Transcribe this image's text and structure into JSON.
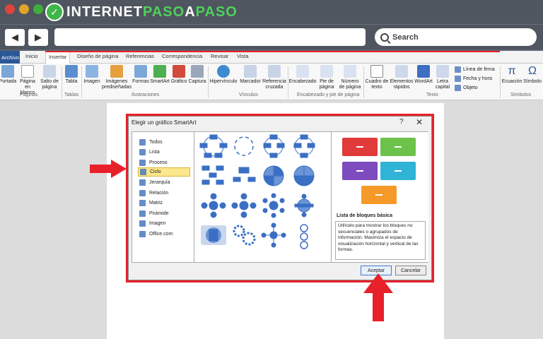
{
  "browser": {
    "brand_prefix": "INTERNET",
    "brand_green": "PASO",
    "brand_mid": "A",
    "brand_suffix": "PASO",
    "back_label": "◀",
    "forward_label": "▶",
    "search_placeholder": "Search"
  },
  "ribbon": {
    "tabs": [
      "Archivo",
      "Inicio",
      "Insertar",
      "Diseño de página",
      "Referencias",
      "Correspondencia",
      "Revisar",
      "Vista"
    ],
    "active_tab": "Insertar",
    "buttons": {
      "portada": "Portada",
      "pagina_blanco": "Página en blanco",
      "salto": "Salto de página",
      "tabla": "Tabla",
      "imagen": "Imagen",
      "imagenes_pred": "Imágenes prediseñadas",
      "formas": "Formas",
      "smartart": "SmartArt",
      "grafico": "Gráfico",
      "captura": "Captura",
      "hipervinculo": "Hipervínculo",
      "marcador": "Marcador",
      "referencia": "Referencia cruzada",
      "encabezado": "Encabezado",
      "pie": "Pie de página",
      "numero": "Número de página",
      "cuadro": "Cuadro de texto",
      "elementos": "Elementos rápidos",
      "wordart": "WordArt",
      "letra": "Letra capital",
      "linea_firma": "Línea de firma",
      "fecha_hora": "Fecha y hora",
      "objeto": "Objeto",
      "ecuacion": "Ecuación",
      "simbolo": "Símbolo"
    },
    "groups": {
      "paginas": "Páginas",
      "tablas": "Tablas",
      "ilustraciones": "Ilustraciones",
      "vinculos": "Vínculos",
      "encabezado_pie": "Encabezado y pie de página",
      "texto": "Texto",
      "simbolos": "Símbolos"
    }
  },
  "dialog": {
    "title": "Elegir un gráfico SmartArt",
    "help": "?",
    "close": "✕",
    "categories": [
      "Todos",
      "Lista",
      "Proceso",
      "Ciclo",
      "Jerarquía",
      "Relación",
      "Matriz",
      "Pirámide",
      "Imagen",
      "Office.com"
    ],
    "selected_category": "Ciclo",
    "preview_title": "Lista de bloques básica",
    "preview_description": "Utilícelo para mostrar los bloques no secuenciales o agrupados de información. Maximiza el espacio de visualización horizontal y vertical de las formas.",
    "ok_label": "Aceptar",
    "cancel_label": "Cancelar"
  },
  "colors": {
    "annotation_red": "#e8202a",
    "brand_green": "#4fd05a",
    "block_red": "#e03a3a",
    "block_green": "#6cc24a",
    "block_purple": "#7d4bbd",
    "block_cyan": "#2fb4d6",
    "block_orange": "#f59a28"
  }
}
